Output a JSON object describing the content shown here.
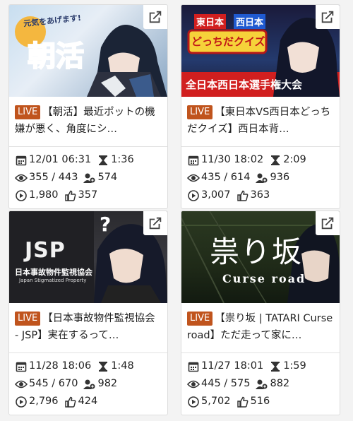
{
  "cards": [
    {
      "badge": "LIVE",
      "title": "【朝活】最近ポットの機嫌が悪く、角度にシ…",
      "thumb_text_main": "朝活",
      "thumb_text_sub": "元気をあげます!",
      "date": "12/01 06:31",
      "duration": "1:36",
      "viewers": "355 / 443",
      "members": "574",
      "plays": "1,980",
      "likes": "357"
    },
    {
      "badge": "LIVE",
      "title": "【東日本VS西日本どっちだクイズ】西日本背…",
      "thumb_text_top_left": "東日本",
      "thumb_text_top_right": "西日本",
      "thumb_text_mid": "どっちだクイズ",
      "thumb_text_bottom": "全日本西日本選手権大会",
      "date": "11/30 18:02",
      "duration": "2:09",
      "viewers": "435 / 614",
      "members": "936",
      "plays": "3,007",
      "likes": "363"
    },
    {
      "badge": "LIVE",
      "title": "【日本事故物件監視協会 - JSP】実在するって…",
      "thumb_text_main": "JSP",
      "thumb_text_sub": "日本事故物件監視協会",
      "thumb_text_sub2": "Japan Stigmatized Property",
      "thumb_text_q": "?",
      "date": "11/28 18:06",
      "duration": "1:48",
      "viewers": "545 / 670",
      "members": "982",
      "plays": "2,796",
      "likes": "424"
    },
    {
      "badge": "LIVE",
      "title": "【祟り坂 | TATARI Curse road】ただ走って家に…",
      "thumb_text_main": "祟り坂",
      "thumb_text_sub": "Curse road",
      "date": "11/27 18:01",
      "duration": "1:59",
      "viewers": "445 / 575",
      "members": "882",
      "plays": "5,702",
      "likes": "516"
    }
  ],
  "colors": {
    "live_badge": "#c0541d",
    "card_bg": "#ffffff",
    "page_bg": "#f3f3f3"
  },
  "icons": [
    "external-link-icon",
    "calendar-icon",
    "hourglass-icon",
    "eye-icon",
    "members-icon",
    "play-icon",
    "thumbs-up-icon"
  ]
}
